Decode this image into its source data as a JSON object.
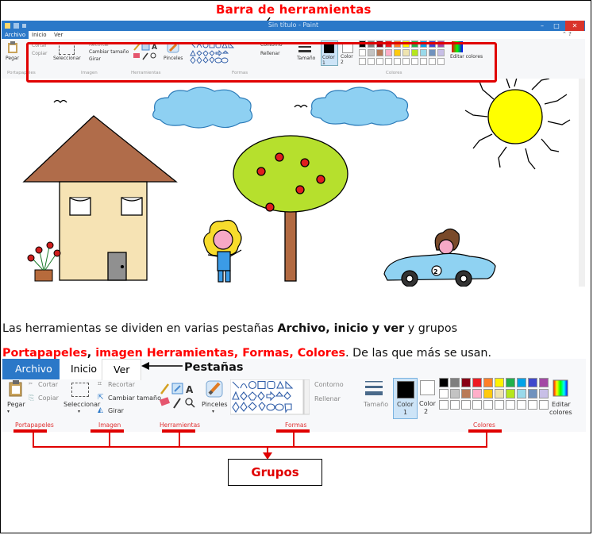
{
  "annotations": {
    "top_title": "Barra de herramientas",
    "tabs_label": "Pestañas",
    "groups_label": "Grupos"
  },
  "paint_window": {
    "title": "Sin título - Paint",
    "tabs": [
      "Archivo",
      "Inicio",
      "Ver"
    ],
    "ribbon_labels": {
      "cortar": "Cortar",
      "copiar": "Copiar",
      "pegar": "Pegar",
      "recortar": "Recortar",
      "cambiar_tamano": "Cambiar tamaño",
      "girar": "Girar",
      "seleccionar": "Seleccionar",
      "pinceles": "Pinceles",
      "contorno": "Contorno",
      "rellenar": "Rellenar",
      "tamano": "Tamaño",
      "color1": "Color 1",
      "color2": "Color 2",
      "editar_colores": "Editar colores"
    },
    "group_labels": [
      "Portapapeles",
      "Imagen",
      "Herramientas",
      "Formas",
      "Colores"
    ]
  },
  "paragraph": {
    "part1": "Las herramientas se dividen en varias pestañas ",
    "bold_tabs": "Archivo, inicio y ver",
    "part2": " y grupos ",
    "red_groups1": "Portapapeles",
    "sep": ", ",
    "red_groups2": "imagen Herramientas, Formas, Colores",
    "part3": ". De las que más se usan."
  },
  "ribbon2": {
    "tabs": [
      "Archivo",
      "Inicio",
      "Ver"
    ],
    "labels": {
      "cortar": "Cortar",
      "copiar": "Copiar",
      "pegar": "Pegar",
      "recortar": "Recortar",
      "cambiar_tamano": "Cambiar tamaño",
      "girar": "Girar",
      "seleccionar": "Seleccionar",
      "pinceles": "Pinceles",
      "contorno": "Contorno",
      "rellenar": "Rellenar",
      "tamano": "Tamaño",
      "color1_a": "Color",
      "color1_b": "1",
      "color2_a": "Color",
      "color2_b": "2",
      "editar_a": "Editar",
      "editar_b": "colores"
    },
    "group_labels": [
      "Portapapeles",
      "Imagen",
      "Herramientas",
      "Formas",
      "Colores"
    ]
  },
  "palette_row1": [
    "#000000",
    "#7f7f7f",
    "#880015",
    "#ed1c24",
    "#ff7f27",
    "#fff200",
    "#22b14c",
    "#00a2e8",
    "#3f48cc",
    "#a349a4"
  ],
  "palette_row2": [
    "#ffffff",
    "#c3c3c3",
    "#b97a57",
    "#ffaec9",
    "#ffc90e",
    "#efe4b0",
    "#b5e61d",
    "#99d9ea",
    "#7092be",
    "#c8bfe7"
  ]
}
